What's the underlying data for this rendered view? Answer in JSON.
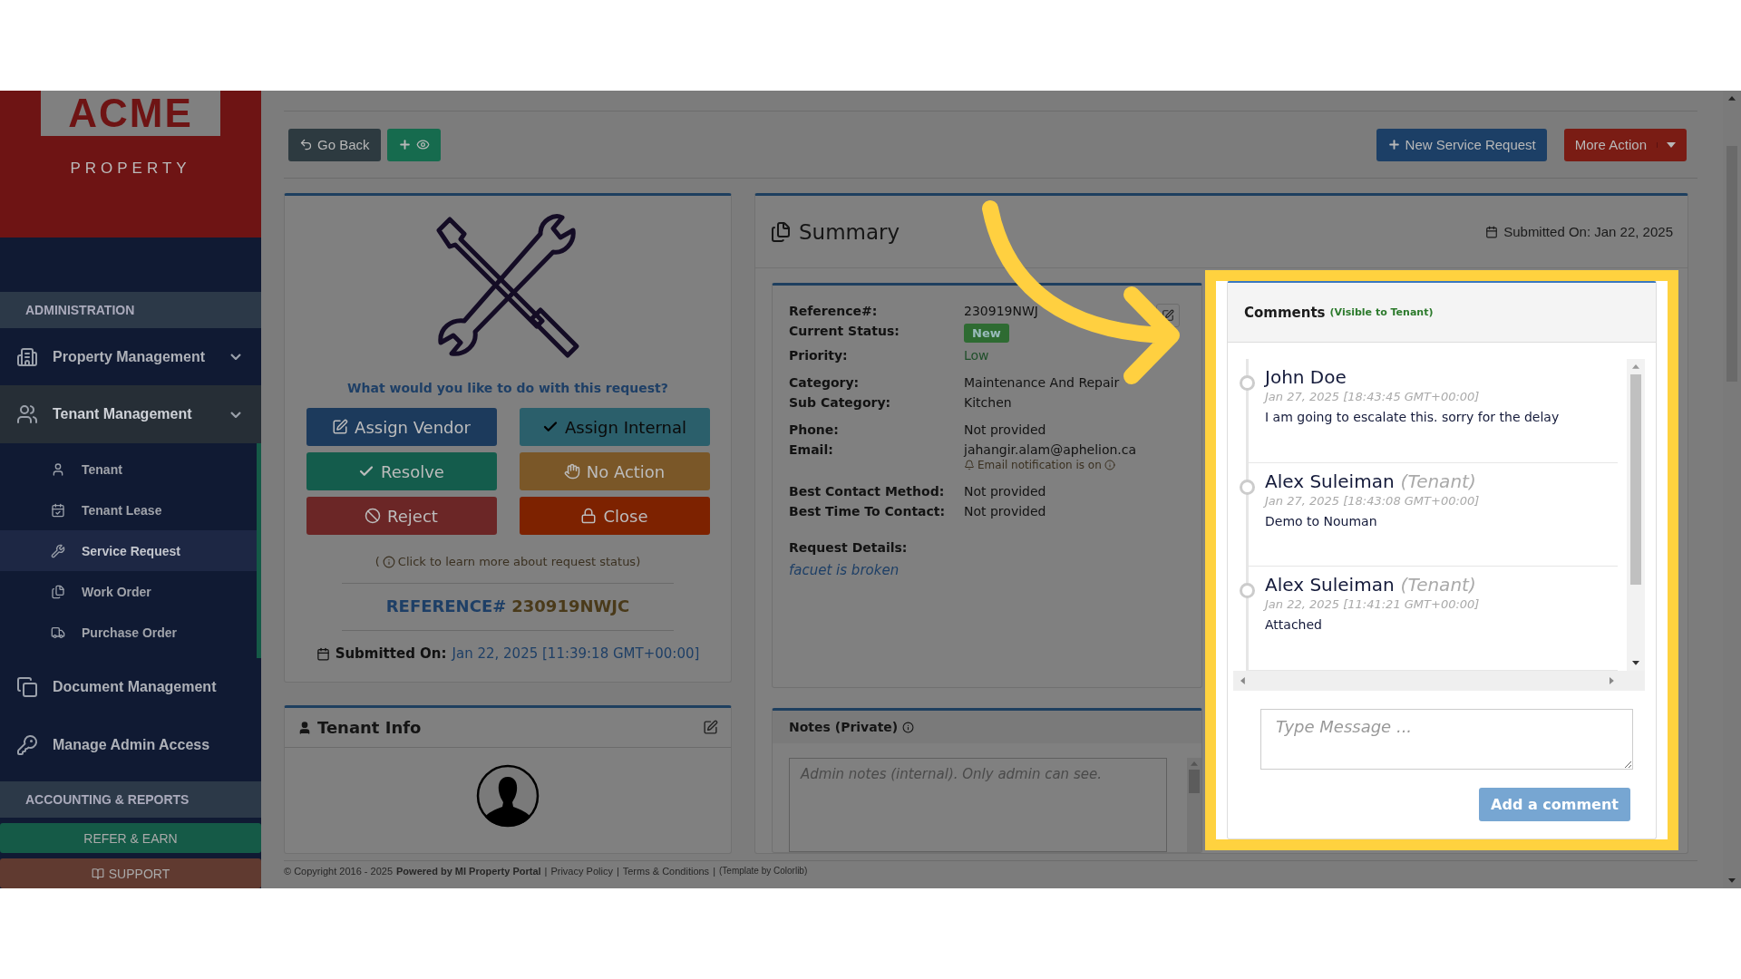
{
  "sidebar": {
    "logo": {
      "wordmark": "ACME",
      "tagline": "PROPERTY"
    },
    "sections": [
      {
        "heading": "ADMINISTRATION",
        "items": [
          {
            "label": "Property Management",
            "has_submenu": true,
            "selected": false
          },
          {
            "label": "Tenant Management",
            "has_submenu": true,
            "selected": true,
            "children": [
              {
                "label": "Tenant",
                "selected": false
              },
              {
                "label": "Tenant Lease",
                "selected": false
              },
              {
                "label": "Service Request",
                "selected": true
              },
              {
                "label": "Work Order",
                "selected": false
              },
              {
                "label": "Purchase Order",
                "selected": false
              }
            ]
          },
          {
            "label": "Document Management",
            "has_submenu": false,
            "selected": false
          },
          {
            "label": "Manage Admin Access",
            "has_submenu": false,
            "selected": false
          }
        ]
      },
      {
        "heading": "ACCOUNTING & REPORTS"
      }
    ],
    "buttons": [
      {
        "label": "REFER & EARN",
        "kind": "plain",
        "color": "#155a47"
      },
      {
        "label": "SUPPORT",
        "kind": "book",
        "color": "#603a30"
      }
    ]
  },
  "toolbar": {
    "back": "Go Back",
    "right": [
      {
        "label": "New Service Request",
        "kind": "plus",
        "color": "#1c3f66"
      },
      {
        "label": "More Action",
        "kind": "split",
        "color": "#7a1c14"
      }
    ]
  },
  "action_card": {
    "question": "What would you like to do with this request?",
    "actions": [
      {
        "label": "Assign Vendor",
        "kind": "edit",
        "color": "#1c3a5c"
      },
      {
        "label": "Assign Internal",
        "kind": "check",
        "color": "#2b5f6b"
      },
      {
        "label": "Resolve",
        "kind": "check",
        "color": "#145c4c"
      },
      {
        "label": "No Action",
        "kind": "hand",
        "color": "#7a5728"
      },
      {
        "label": "Reject",
        "kind": "ban",
        "color": "#6b2626"
      },
      {
        "label": "Close",
        "kind": "lock",
        "color": "#7d2200"
      }
    ],
    "hint_open": "(",
    "hint": "Click to learn more about request status)",
    "reference_label": "REFERENCE#",
    "reference": "230919NWJC",
    "submitted_label": "Submitted On:",
    "submitted": "Jan 22, 2025 [11:39:18 GMT+00:00]"
  },
  "tenant_info": {
    "title": "Tenant Info"
  },
  "summary": {
    "title": "Summary",
    "submitted_label": "Submitted On:",
    "submitted": "Jan 22, 2025",
    "detail_groups": [
      [
        {
          "label": "Reference#:",
          "value": "230919NWJ",
          "kind": "text"
        },
        {
          "label": "Current Status:",
          "value": "New",
          "kind": "badge"
        },
        {
          "label": "Priority:",
          "value": "Low",
          "kind": "priority"
        }
      ],
      [
        {
          "label": "Category:",
          "value": "Maintenance And Repair",
          "kind": "text"
        },
        {
          "label": "Sub Category:",
          "value": "Kitchen",
          "kind": "text"
        }
      ],
      [
        {
          "label": "Phone:",
          "value": "Not provided",
          "kind": "text"
        },
        {
          "label": "Email:",
          "value": "jahangir.alam@aphelion.ca",
          "kind": "email",
          "note": "Email notification is on"
        }
      ],
      [
        {
          "label": "Best Contact Method:",
          "value": "Not provided",
          "kind": "text"
        },
        {
          "label": "Best Time To Contact:",
          "value": "Not provided",
          "kind": "text"
        }
      ]
    ],
    "request_label": "Request Details:",
    "request": "facuet is broken"
  },
  "notes": {
    "title": "Notes (Private)",
    "placeholder": "Admin notes (internal). Only admin can see."
  },
  "comments": {
    "title": "Comments",
    "subtitle": "(Visible to Tenant)",
    "items": [
      {
        "author": "John Doe",
        "time": "Jan 27, 2025 [18:43:45 GMT+00:00]",
        "text": "I am going to escalate this. sorry for the delay"
      },
      {
        "author": "Alex Suleiman",
        "role": "(Tenant)",
        "time": "Jan 27, 2025 [18:43:08 GMT+00:00]",
        "text": "Demo to Nouman"
      },
      {
        "author": "Alex Suleiman",
        "role": "(Tenant)",
        "time": "Jan 22, 2025 [11:41:21 GMT+00:00]",
        "text": "Attached"
      }
    ],
    "placeholder": "Type Message ...",
    "button": "Add a comment"
  },
  "footer": {
    "copyright": "© Copyright 2016 - 2025",
    "powered": "Powered by MI Property Portal",
    "separator": "|",
    "links": [
      "Privacy Policy",
      "Terms & Conditions"
    ],
    "template": "(Template by Colorlib)"
  }
}
